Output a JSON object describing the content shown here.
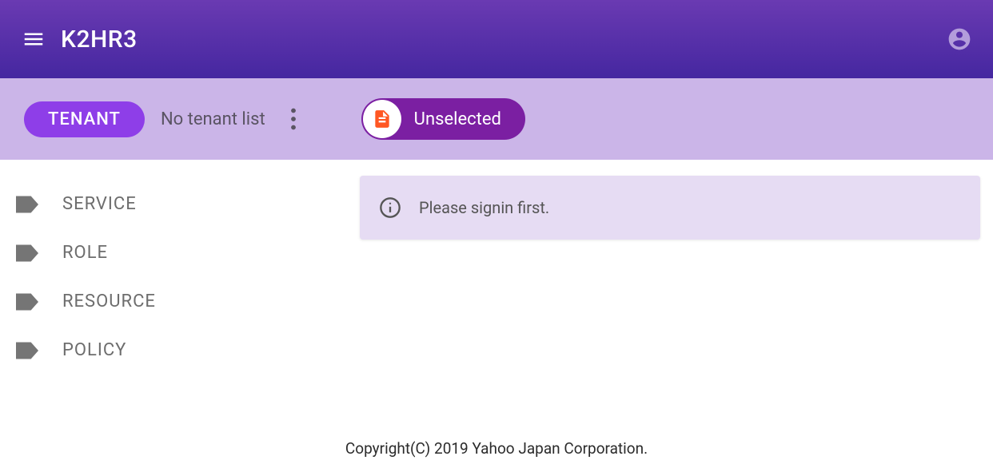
{
  "header": {
    "title": "K2HR3"
  },
  "toolbar": {
    "tenant_label": "TENANT",
    "tenant_status": "No tenant list",
    "unselected_label": "Unselected"
  },
  "sidebar": {
    "items": [
      {
        "label": "SERVICE"
      },
      {
        "label": "ROLE"
      },
      {
        "label": "RESOURCE"
      },
      {
        "label": "POLICY"
      }
    ]
  },
  "content": {
    "info_message": "Please signin first."
  },
  "footer": {
    "copyright": "Copyright(C) 2019 Yahoo Japan Corporation."
  }
}
